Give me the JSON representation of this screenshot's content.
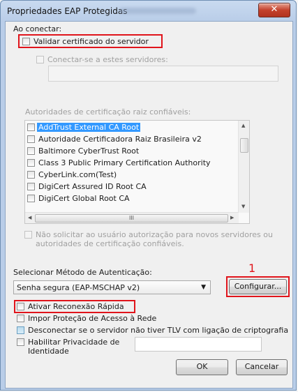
{
  "window": {
    "title": "Propriedades EAP Protegidas",
    "close_glyph": "✕"
  },
  "group": {
    "label": "Ao conectar:",
    "validate_cert": "Validar certificado do servidor",
    "connect_servers": "Conectar-se a estes servidores:",
    "servers_value": "",
    "trusted_roots_label": "Autoridades de certificação raiz confiáveis:",
    "authorities": [
      "AddTrust External CA Root",
      "Autoridade Certificadora Raiz Brasileira v2",
      "Baltimore CyberTrust Root",
      "Class 3 Public Primary Certification Authority",
      "CyberLink.com(Test)",
      "DigiCert Assured ID Root CA",
      "DigiCert Global Root CA"
    ],
    "hscroll_grip": "III",
    "no_prompt": "Não solicitar ao usuário autorização para novos servidores ou autoridades de certificação confiáveis."
  },
  "auth": {
    "label": "Selecionar Método de Autenticação:",
    "method": "Senha segura (EAP-MSCHAP v2)",
    "configure": "Configurar...",
    "annotation": "1"
  },
  "options": {
    "fast_reconnect": "Ativar Reconexão Rápida",
    "nap": "Impor Proteção de Acesso à Rede",
    "disconnect_tlv": "Desconectar se o servidor não tiver TLV com ligação de criptografia",
    "identity_privacy": "Habilitar Privacidade de Identidade",
    "identity_value": ""
  },
  "buttons": {
    "ok": "OK",
    "cancel": "Cancelar"
  },
  "colors": {
    "highlight": "#e0141b",
    "selection": "#3399ff"
  }
}
